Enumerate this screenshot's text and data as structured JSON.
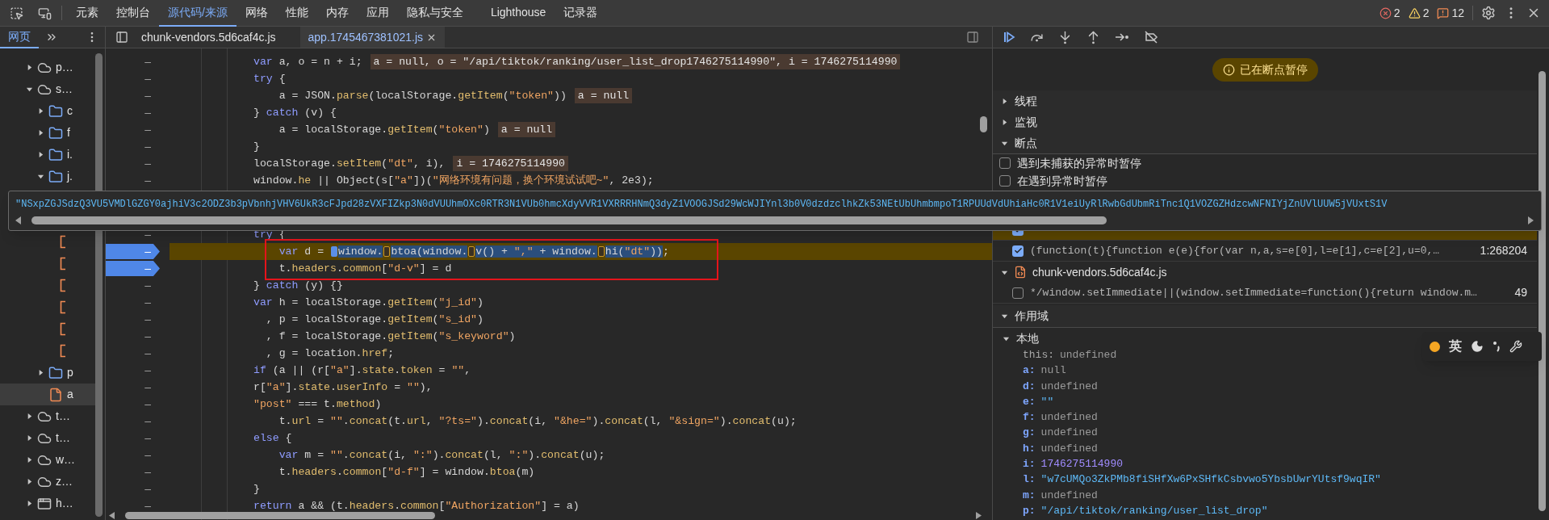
{
  "toolbar": {
    "tabs": [
      {
        "label": "元素",
        "selected": false
      },
      {
        "label": "控制台",
        "selected": false
      },
      {
        "label": "源代码/来源",
        "selected": true
      },
      {
        "label": "网络",
        "selected": false
      },
      {
        "label": "性能",
        "selected": false
      },
      {
        "label": "内存",
        "selected": false
      },
      {
        "label": "应用",
        "selected": false
      },
      {
        "label": "隐私与安全",
        "selected": false
      },
      {
        "label": "Lighthouse",
        "selected": false
      },
      {
        "label": "记录器",
        "selected": false
      }
    ],
    "counters": [
      {
        "kind": "error",
        "count": "2"
      },
      {
        "kind": "warning",
        "count": "2"
      },
      {
        "kind": "issue",
        "count": "12"
      }
    ]
  },
  "navigator": {
    "tabs": [
      {
        "label": "网页",
        "selected": true
      }
    ],
    "tree": [
      {
        "kind": "domain",
        "label": "p…",
        "expanded": false,
        "selected": false
      },
      {
        "kind": "domain",
        "label": "s…",
        "expanded": true,
        "selected": false,
        "children": [
          {
            "kind": "folder",
            "label": "c",
            "expanded": false,
            "selected": false
          },
          {
            "kind": "folder",
            "label": "f",
            "expanded": false,
            "selected": false
          },
          {
            "kind": "folder",
            "label": "i.",
            "expanded": false,
            "selected": false
          },
          {
            "kind": "folder",
            "label": "j.",
            "expanded": true,
            "selected": false,
            "children": [
              {
                "kind": "file",
                "selected": false
              },
              {
                "kind": "file",
                "selected": false
              },
              {
                "kind": "file",
                "selected": false
              },
              {
                "kind": "file",
                "selected": false
              },
              {
                "kind": "file",
                "selected": false
              },
              {
                "kind": "file",
                "selected": false
              }
            ]
          },
          {
            "kind": "folder",
            "label": "p",
            "expanded": false,
            "selected": false
          },
          {
            "kind": "file",
            "label": "a",
            "selected": true
          }
        ]
      },
      {
        "kind": "domain",
        "label": "t…",
        "expanded": false,
        "selected": false
      },
      {
        "kind": "domain",
        "label": "t…",
        "expanded": false,
        "selected": false
      },
      {
        "kind": "domain",
        "label": "w…",
        "expanded": false,
        "selected": false
      },
      {
        "kind": "domain",
        "label": "z…",
        "expanded": false,
        "selected": false
      },
      {
        "kind": "frame",
        "label": "h…",
        "expanded": false,
        "selected": false
      }
    ]
  },
  "editor_tabs": [
    {
      "label": "chunk-vendors.5d6caf4c.js",
      "selected": false
    },
    {
      "label": "app.1745467381021.js",
      "selected": true
    }
  ],
  "code": {
    "lines_above": [
      {
        "gutter": "–",
        "breakpoint": false,
        "paused": false,
        "segments": [
          {
            "kind": "kw",
            "text": "var"
          },
          {
            "kind": "plain",
            "text": " a, o = n + i;"
          }
        ],
        "inline": "a = null, o = \"/api/tiktok/ranking/user_list_drop1746275114990\", i = 1746275114990"
      },
      {
        "gutter": "–",
        "breakpoint": false,
        "paused": false,
        "segments": [
          {
            "kind": "kw",
            "text": "try"
          },
          {
            "kind": "plain",
            "text": " {"
          }
        ]
      },
      {
        "gutter": "–",
        "breakpoint": false,
        "paused": false,
        "segments": [
          {
            "kind": "plain",
            "text": "    a = JSON."
          },
          {
            "kind": "prop",
            "text": "parse"
          },
          {
            "kind": "plain",
            "text": "(localStorage."
          },
          {
            "kind": "prop",
            "text": "getItem"
          },
          {
            "kind": "plain",
            "text": "("
          },
          {
            "kind": "str",
            "text": "\"token\""
          },
          {
            "kind": "plain",
            "text": "))"
          }
        ],
        "inline": "a = null"
      },
      {
        "gutter": "–",
        "breakpoint": false,
        "paused": false,
        "segments": [
          {
            "kind": "plain",
            "text": "} "
          },
          {
            "kind": "kw",
            "text": "catch"
          },
          {
            "kind": "plain",
            "text": " (v) {"
          }
        ]
      },
      {
        "gutter": "–",
        "breakpoint": false,
        "paused": false,
        "segments": [
          {
            "kind": "plain",
            "text": "    a = localStorage."
          },
          {
            "kind": "prop",
            "text": "getItem"
          },
          {
            "kind": "plain",
            "text": "("
          },
          {
            "kind": "str",
            "text": "\"token\""
          },
          {
            "kind": "plain",
            "text": ")"
          }
        ],
        "inline": "a = null"
      },
      {
        "gutter": "–",
        "breakpoint": false,
        "paused": false,
        "segments": [
          {
            "kind": "plain",
            "text": "}"
          }
        ]
      },
      {
        "gutter": "–",
        "breakpoint": false,
        "paused": false,
        "segments": [
          {
            "kind": "plain",
            "text": "localStorage."
          },
          {
            "kind": "prop",
            "text": "setItem"
          },
          {
            "kind": "plain",
            "text": "("
          },
          {
            "kind": "str",
            "text": "\"dt\""
          },
          {
            "kind": "plain",
            "text": ", i),"
          }
        ],
        "inline": "i = 1746275114990"
      },
      {
        "gutter": "–",
        "breakpoint": false,
        "paused": false,
        "segments": [
          {
            "kind": "plain",
            "text": "window."
          },
          {
            "kind": "prop",
            "text": "he"
          },
          {
            "kind": "plain",
            "text": " || Object(s["
          },
          {
            "kind": "str",
            "text": "\"a\""
          },
          {
            "kind": "plain",
            "text": "])("
          },
          {
            "kind": "str",
            "text": "\"网络环境有问题，换个环境试试吧~\""
          },
          {
            "kind": "plain",
            "text": ", 2e3);"
          }
        ]
      }
    ],
    "lines_below": [
      {
        "gutter": "–",
        "breakpoint": false,
        "paused": false,
        "segments": [
          {
            "kind": "kw",
            "text": "try"
          },
          {
            "kind": "plain",
            "text": " {"
          }
        ]
      },
      {
        "gutter": "–",
        "breakpoint": true,
        "paused": true,
        "segments": [
          {
            "kind": "kw",
            "text": "    var",
            "sel": false
          },
          {
            "kind": "plain",
            "text": " d = ",
            "sel": false
          },
          {
            "kind": "stop",
            "current": true
          },
          {
            "kind": "plain",
            "text": "window.",
            "sel": true
          },
          {
            "kind": "stop",
            "current": false
          },
          {
            "kind": "plain",
            "text": "btoa(window.",
            "sel": true
          },
          {
            "kind": "stop",
            "current": false
          },
          {
            "kind": "plain",
            "text": "v() + ",
            "sel": true
          },
          {
            "kind": "str",
            "text": "\",\"",
            "sel": true
          },
          {
            "kind": "plain",
            "text": " + window.",
            "sel": true
          },
          {
            "kind": "stop",
            "current": false
          },
          {
            "kind": "plain",
            "text": "hi(",
            "sel": true
          },
          {
            "kind": "str",
            "text": "\"dt\"",
            "sel": true
          },
          {
            "kind": "plain",
            "text": "))",
            "sel": true
          },
          {
            "kind": "plain",
            "text": ";",
            "sel": false
          }
        ]
      },
      {
        "gutter": "–",
        "breakpoint": true,
        "paused": false,
        "segments": [
          {
            "kind": "plain",
            "text": "    t."
          },
          {
            "kind": "prop",
            "text": "headers"
          },
          {
            "kind": "plain",
            "text": "."
          },
          {
            "kind": "prop",
            "text": "common"
          },
          {
            "kind": "plain",
            "text": "["
          },
          {
            "kind": "str",
            "text": "\"d-v\""
          },
          {
            "kind": "plain",
            "text": "] = d"
          }
        ]
      },
      {
        "gutter": "–",
        "breakpoint": false,
        "paused": false,
        "segments": [
          {
            "kind": "plain",
            "text": "} "
          },
          {
            "kind": "kw",
            "text": "catch"
          },
          {
            "kind": "plain",
            "text": " (y) {}"
          }
        ]
      },
      {
        "gutter": "–",
        "breakpoint": false,
        "paused": false,
        "segments": [
          {
            "kind": "kw",
            "text": "var"
          },
          {
            "kind": "plain",
            "text": " h = localStorage."
          },
          {
            "kind": "prop",
            "text": "getItem"
          },
          {
            "kind": "plain",
            "text": "("
          },
          {
            "kind": "str",
            "text": "\"j_id\""
          },
          {
            "kind": "plain",
            "text": ")"
          }
        ]
      },
      {
        "gutter": "–",
        "breakpoint": false,
        "paused": false,
        "segments": [
          {
            "kind": "plain",
            "text": "  , p = localStorage."
          },
          {
            "kind": "prop",
            "text": "getItem"
          },
          {
            "kind": "plain",
            "text": "("
          },
          {
            "kind": "str",
            "text": "\"s_id\""
          },
          {
            "kind": "plain",
            "text": ")"
          }
        ]
      },
      {
        "gutter": "–",
        "breakpoint": false,
        "paused": false,
        "segments": [
          {
            "kind": "plain",
            "text": "  , f = localStorage."
          },
          {
            "kind": "prop",
            "text": "getItem"
          },
          {
            "kind": "plain",
            "text": "("
          },
          {
            "kind": "str",
            "text": "\"s_keyword\""
          },
          {
            "kind": "plain",
            "text": ")"
          }
        ]
      },
      {
        "gutter": "–",
        "breakpoint": false,
        "paused": false,
        "segments": [
          {
            "kind": "plain",
            "text": "  , g = location."
          },
          {
            "kind": "prop",
            "text": "href"
          },
          {
            "kind": "plain",
            "text": ";"
          }
        ]
      },
      {
        "gutter": "–",
        "breakpoint": false,
        "paused": false,
        "segments": [
          {
            "kind": "kw",
            "text": "if"
          },
          {
            "kind": "plain",
            "text": " (a || (r["
          },
          {
            "kind": "str",
            "text": "\"a\""
          },
          {
            "kind": "plain",
            "text": "]."
          },
          {
            "kind": "prop",
            "text": "state"
          },
          {
            "kind": "plain",
            "text": "."
          },
          {
            "kind": "prop",
            "text": "token"
          },
          {
            "kind": "plain",
            "text": " = "
          },
          {
            "kind": "str",
            "text": "\"\""
          },
          {
            "kind": "plain",
            "text": ","
          }
        ]
      },
      {
        "gutter": "–",
        "breakpoint": false,
        "paused": false,
        "segments": [
          {
            "kind": "plain",
            "text": "r["
          },
          {
            "kind": "str",
            "text": "\"a\""
          },
          {
            "kind": "plain",
            "text": "]."
          },
          {
            "kind": "prop",
            "text": "state"
          },
          {
            "kind": "plain",
            "text": "."
          },
          {
            "kind": "prop",
            "text": "userInfo"
          },
          {
            "kind": "plain",
            "text": " = "
          },
          {
            "kind": "str",
            "text": "\"\""
          },
          {
            "kind": "plain",
            "text": "),"
          }
        ]
      },
      {
        "gutter": "–",
        "breakpoint": false,
        "paused": false,
        "segments": [
          {
            "kind": "str",
            "text": "\"post\""
          },
          {
            "kind": "plain",
            "text": " === t."
          },
          {
            "kind": "prop",
            "text": "method"
          },
          {
            "kind": "plain",
            "text": ")"
          }
        ]
      },
      {
        "gutter": "–",
        "breakpoint": false,
        "paused": false,
        "segments": [
          {
            "kind": "plain",
            "text": "    t."
          },
          {
            "kind": "prop",
            "text": "url"
          },
          {
            "kind": "plain",
            "text": " = "
          },
          {
            "kind": "str",
            "text": "\"\""
          },
          {
            "kind": "plain",
            "text": "."
          },
          {
            "kind": "prop",
            "text": "concat"
          },
          {
            "kind": "plain",
            "text": "(t."
          },
          {
            "kind": "prop",
            "text": "url"
          },
          {
            "kind": "plain",
            "text": ", "
          },
          {
            "kind": "str",
            "text": "\"?ts=\""
          },
          {
            "kind": "plain",
            "text": ")."
          },
          {
            "kind": "prop",
            "text": "concat"
          },
          {
            "kind": "plain",
            "text": "(i, "
          },
          {
            "kind": "str",
            "text": "\"&he=\""
          },
          {
            "kind": "plain",
            "text": ")."
          },
          {
            "kind": "prop",
            "text": "concat"
          },
          {
            "kind": "plain",
            "text": "(l, "
          },
          {
            "kind": "str",
            "text": "\"&sign=\""
          },
          {
            "kind": "plain",
            "text": ")."
          },
          {
            "kind": "prop",
            "text": "concat"
          },
          {
            "kind": "plain",
            "text": "(u);"
          }
        ]
      },
      {
        "gutter": "–",
        "breakpoint": false,
        "paused": false,
        "segments": [
          {
            "kind": "kw",
            "text": "else"
          },
          {
            "kind": "plain",
            "text": " {"
          }
        ]
      },
      {
        "gutter": "–",
        "breakpoint": false,
        "paused": false,
        "segments": [
          {
            "kind": "kw",
            "text": "    var"
          },
          {
            "kind": "plain",
            "text": " m = "
          },
          {
            "kind": "str",
            "text": "\"\""
          },
          {
            "kind": "plain",
            "text": "."
          },
          {
            "kind": "prop",
            "text": "concat"
          },
          {
            "kind": "plain",
            "text": "(i, "
          },
          {
            "kind": "str",
            "text": "\":\""
          },
          {
            "kind": "plain",
            "text": ")."
          },
          {
            "kind": "prop",
            "text": "concat"
          },
          {
            "kind": "plain",
            "text": "(l, "
          },
          {
            "kind": "str",
            "text": "\":\""
          },
          {
            "kind": "plain",
            "text": ")."
          },
          {
            "kind": "prop",
            "text": "concat"
          },
          {
            "kind": "plain",
            "text": "(u);"
          }
        ]
      },
      {
        "gutter": "–",
        "breakpoint": false,
        "paused": false,
        "segments": [
          {
            "kind": "plain",
            "text": "    t."
          },
          {
            "kind": "prop",
            "text": "headers"
          },
          {
            "kind": "plain",
            "text": "."
          },
          {
            "kind": "prop",
            "text": "common"
          },
          {
            "kind": "plain",
            "text": "["
          },
          {
            "kind": "str",
            "text": "\"d-f\""
          },
          {
            "kind": "plain",
            "text": "] = window."
          },
          {
            "kind": "prop",
            "text": "btoa"
          },
          {
            "kind": "plain",
            "text": "(m)"
          }
        ]
      },
      {
        "gutter": "–",
        "breakpoint": false,
        "paused": false,
        "segments": [
          {
            "kind": "plain",
            "text": "}"
          }
        ]
      },
      {
        "gutter": "–",
        "breakpoint": false,
        "paused": false,
        "segments": [
          {
            "kind": "kw",
            "text": "return"
          },
          {
            "kind": "plain",
            "text": " a && (t."
          },
          {
            "kind": "prop",
            "text": "headers"
          },
          {
            "kind": "plain",
            "text": "."
          },
          {
            "kind": "prop",
            "text": "common"
          },
          {
            "kind": "plain",
            "text": "["
          },
          {
            "kind": "str",
            "text": "\"Authorization\""
          },
          {
            "kind": "plain",
            "text": "] = a)"
          }
        ]
      }
    ]
  },
  "tooltip": {
    "text": "\"NSxpZGJSdzQ3VU5VMDlGZGY0ajhiV3c2ODZ3b3pVbnhjVHV6UkR3cFJpd28zVXFIZkp3N0dVUUhmOXc0RTR3N1VUb0hmcXdyVVR1VXRRRHNmQ3dyZ1VOOGJSd29WcWJIYnl3b0V0dzdzclhkZk53NEtUbUhmbmpoT1RPUUdVdUhiaHc0R1V1eiUyRlRwbGdUbmRiTnc1Q1VOZGZHdzcwNFNIYjZnUVlUUW5jVUxtS1V"
  },
  "debugger": {
    "status": "已在断点暂停",
    "sections": [
      {
        "label": "线程",
        "expanded": false
      },
      {
        "label": "监视",
        "expanded": false
      },
      {
        "label": "断点",
        "expanded": true
      }
    ],
    "exception_options": [
      {
        "label": "遇到未捕获的异常时暂停",
        "checked": false
      },
      {
        "label": "在遇到异常时暂停",
        "checked": false
      }
    ],
    "breakpoints": [
      {
        "kind": "breakpoint",
        "checked": true,
        "paused": true
      },
      {
        "kind": "breakpoint",
        "checked": true,
        "paused": false,
        "code": "(function(t){function e(e){for(var n,a,s=e[0],l=e[1],c=e[2],u=0,…",
        "location": "1:268204"
      },
      {
        "kind": "file",
        "label": "chunk-vendors.5d6caf4c.js",
        "expanded": true
      },
      {
        "kind": "breakpoint",
        "checked": false,
        "paused": false,
        "code": "*/window.setImmediate||(window.setImmediate=function(){return window.m…",
        "location": "49"
      }
    ],
    "scope": {
      "label": "作用域",
      "expanded": true,
      "groups": [
        {
          "label": "本地",
          "expanded": true,
          "variables": [
            {
              "kind": "receiver",
              "name": "this:",
              "value": "undefined"
            },
            {
              "kind": "empty",
              "name": "a:",
              "value": "null"
            },
            {
              "kind": "empty",
              "name": "d:",
              "value": "undefined"
            },
            {
              "kind": "string",
              "name": "e:",
              "value": "\"\""
            },
            {
              "kind": "empty",
              "name": "f:",
              "value": "undefined"
            },
            {
              "kind": "empty",
              "name": "g:",
              "value": "undefined"
            },
            {
              "kind": "empty",
              "name": "h:",
              "value": "undefined"
            },
            {
              "kind": "number",
              "name": "i:",
              "value": "1746275114990"
            },
            {
              "kind": "string",
              "name": "l:",
              "value": "\"w7cUMQo3ZkPMb8fiSHfXw6PxSHfkCsbvwo5YbsbUwrYUtsf9wqIR\""
            },
            {
              "kind": "empty",
              "name": "m:",
              "value": "undefined"
            },
            {
              "kind": "string",
              "name": "p:",
              "value": "\"/api/tiktok/ranking/user_list_drop\""
            }
          ]
        }
      ]
    }
  },
  "ime": {
    "label": "英"
  }
}
